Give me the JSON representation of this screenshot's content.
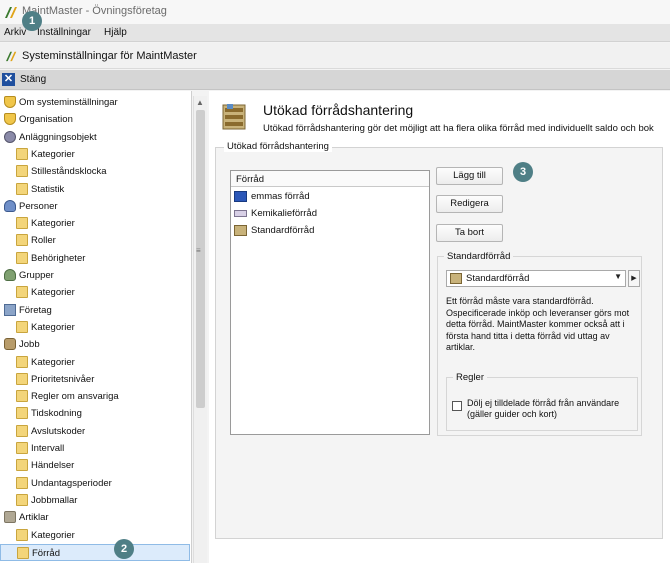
{
  "window": {
    "title": "MaintMaster - Övningsföretag"
  },
  "menu": {
    "items": [
      "Arkiv",
      "Inställningar",
      "Hjälp"
    ]
  },
  "document": {
    "title": "Systeminställningar för MaintMaster"
  },
  "closebar": {
    "label": "Stäng"
  },
  "sidebar": {
    "items": [
      {
        "label": "Om systeminställningar",
        "icon": "shield-icon",
        "level": 0
      },
      {
        "label": "Organisation",
        "icon": "shield-icon",
        "level": 0
      },
      {
        "label": "Anläggningsobjekt",
        "icon": "gear-icon",
        "level": 0
      },
      {
        "label": "Kategorier",
        "icon": "folder-icon",
        "level": 1
      },
      {
        "label": "Stilleståndsklocka",
        "icon": "folder-icon",
        "level": 1
      },
      {
        "label": "Statistik",
        "icon": "folder-icon",
        "level": 1
      },
      {
        "label": "Personer",
        "icon": "person-icon",
        "level": 0
      },
      {
        "label": "Kategorier",
        "icon": "folder-icon",
        "level": 1
      },
      {
        "label": "Roller",
        "icon": "folder-icon",
        "level": 1
      },
      {
        "label": "Behörigheter",
        "icon": "folder-icon",
        "level": 1
      },
      {
        "label": "Grupper",
        "icon": "group-icon",
        "level": 0
      },
      {
        "label": "Kategorier",
        "icon": "folder-icon",
        "level": 1
      },
      {
        "label": "Företag",
        "icon": "company-icon",
        "level": 0
      },
      {
        "label": "Kategorier",
        "icon": "folder-icon",
        "level": 1
      },
      {
        "label": "Jobb",
        "icon": "job-icon",
        "level": 0
      },
      {
        "label": "Kategorier",
        "icon": "folder-icon",
        "level": 1
      },
      {
        "label": "Prioritetsnivåer",
        "icon": "folder-icon",
        "level": 1
      },
      {
        "label": "Regler om ansvariga",
        "icon": "folder-icon",
        "level": 1
      },
      {
        "label": "Tidskodning",
        "icon": "folder-icon",
        "level": 1
      },
      {
        "label": "Avslutskoder",
        "icon": "folder-icon",
        "level": 1
      },
      {
        "label": "Intervall",
        "icon": "folder-icon",
        "level": 1
      },
      {
        "label": "Händelser",
        "icon": "folder-icon",
        "level": 1
      },
      {
        "label": "Undantagsperioder",
        "icon": "folder-icon",
        "level": 1
      },
      {
        "label": "Jobbmallar",
        "icon": "folder-icon",
        "level": 1
      },
      {
        "label": "Artiklar",
        "icon": "article-icon",
        "level": 0
      },
      {
        "label": "Kategorier",
        "icon": "folder-icon",
        "level": 1
      },
      {
        "label": "Förråd",
        "icon": "folder-icon",
        "level": 1,
        "selected": true
      }
    ]
  },
  "main": {
    "heading": "Utökad förrådshantering",
    "description": "Utökad förrådshantering gör det möjligt att ha flera olika förråd med individuellt saldo och bok",
    "group_label": "Utökad förrådshantering",
    "list": {
      "header": "Förråd",
      "rows": [
        {
          "label": "emmas förråd",
          "icon": "blue-store-icon"
        },
        {
          "label": "Kemikalieförråd",
          "icon": "tray-icon"
        },
        {
          "label": "Standardförråd",
          "icon": "shelf-icon"
        }
      ]
    },
    "buttons": {
      "add": "Lägg till",
      "edit": "Redigera",
      "delete": "Ta bort"
    },
    "standard": {
      "label": "Standardförråd",
      "selected": "Standardförråd",
      "note": "Ett förråd måste vara standardförråd. Ospecificerade inköp och leveranser görs mot detta förråd. MaintMaster kommer också att i första hand titta i detta förråd vid uttag av artiklar."
    },
    "rules": {
      "label": "Regler",
      "checkbox_label": "Dölj ej tilldelade förråd från användare (gäller guider och kort)",
      "checked": false
    }
  },
  "badges": [
    "1",
    "2",
    "3"
  ],
  "colors": {
    "accent": "#1f4f9e",
    "badge": "#4f7f86",
    "selection": "#dcebfb"
  }
}
